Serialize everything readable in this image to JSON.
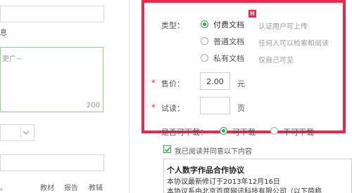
{
  "left_panel": {
    "partial_title": "息",
    "textarea_partial_text": "更广~",
    "char_count": "200",
    "tags": [
      "教材",
      "报告",
      "教辅"
    ],
    "tag_prefix": "。"
  },
  "form": {
    "type_label": "类型：",
    "new_badge": "H",
    "options": [
      {
        "label": "付费文档",
        "desc": "认证用户可上传",
        "selected": true
      },
      {
        "label": "普通文档",
        "desc": "任何人可以检索和阅读",
        "selected": false
      },
      {
        "label": "私有文档",
        "desc": "仅自己可见",
        "selected": false
      }
    ],
    "required_mark": "*",
    "price_label": "售价：",
    "price_value": "2.00",
    "price_unit": "元",
    "trial_label": "试读：",
    "trial_value": "",
    "trial_unit": "页",
    "downloadable_label": "是否可下载：",
    "download_options": [
      {
        "label": "可下载",
        "selected": true
      },
      {
        "label": "不可下载",
        "selected": false
      }
    ],
    "agree_text": "我已阅读并同意以下内容"
  },
  "agreement": {
    "title": "个人数字作品合作协议",
    "line1": "本协议最新修订于2013年12月16日",
    "line2_partial": "本协议系由北京百度网讯科技有限公司（以下简称"
  },
  "colors": {
    "accent_green": "#2eaa4f",
    "highlight_red": "#e6294d"
  }
}
